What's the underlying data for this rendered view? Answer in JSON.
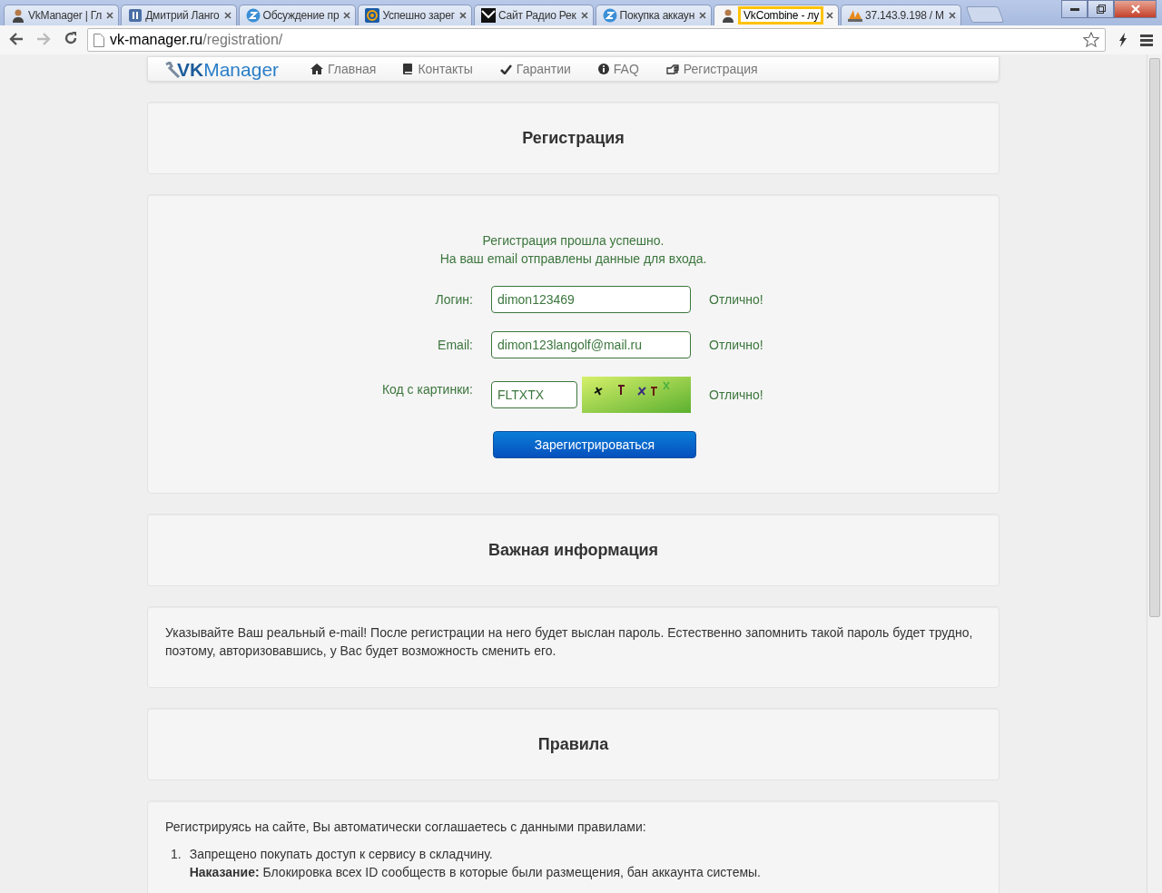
{
  "browser": {
    "tabs": [
      {
        "title": "VkManager | Гл",
        "kind": "person",
        "selected": false,
        "highlighted": false
      },
      {
        "title": "Дмитрий Ланго",
        "kind": "pause",
        "selected": false,
        "highlighted": false
      },
      {
        "title": "Обсуждение пр",
        "kind": "z",
        "selected": false,
        "highlighted": false
      },
      {
        "title": "Успешно зарег",
        "kind": "at",
        "selected": false,
        "highlighted": false
      },
      {
        "title": "Сайт Радио Рек",
        "kind": "mail",
        "selected": false,
        "highlighted": false
      },
      {
        "title": "Покупка аккаун",
        "kind": "z",
        "selected": false,
        "highlighted": false
      },
      {
        "title": "VkCombine - лу",
        "kind": "person",
        "selected": true,
        "highlighted": true
      },
      {
        "title": "37.143.9.198 / М",
        "kind": "pma",
        "selected": false,
        "highlighted": false
      }
    ],
    "address": "vk-manager.ru/registration/"
  },
  "site": {
    "logo": "**VK**Manager",
    "nav": [
      {
        "label": "Главная",
        "kind": "home"
      },
      {
        "label": "Контакты",
        "kind": "book"
      },
      {
        "label": "Гарантии",
        "kind": "check"
      },
      {
        "label": "FAQ",
        "kind": "info"
      },
      {
        "label": "Регистрация",
        "kind": "hand"
      }
    ]
  },
  "registration": {
    "title": "Регистрация",
    "success": [
      "Регистрация прошла успешно.",
      "На ваш email отправлены данные для входа."
    ],
    "fields": [
      {
        "kind": "text",
        "label": "Логин:",
        "value": "dimon123469",
        "status": "Отлично!"
      },
      {
        "kind": "text",
        "label": "Email:",
        "value": "dimon123langolf@mail.ru",
        "status": "Отлично!"
      },
      {
        "kind": "captcha",
        "label": "Код с картинки:",
        "value": "FLTXTX",
        "status": "Отлично!"
      }
    ],
    "submit": "Зарегистрироваться"
  },
  "important": {
    "title": "Важная информация",
    "text": "Указывайте Ваш реальный e-mail! После регистрации на него будет выслан пароль. Естественно запомнить такой пароль будет трудно, поэтому, авторизовавшись, у Вас будет возможность сменить его."
  },
  "rules": {
    "title": "Правила",
    "intro": "Регистрируясь на сайте, Вы автоматически соглашаетесь с данными правилами:",
    "items": [
      {
        "number": "1.",
        "text": "Запрещено покупать доступ к сервису в складчину.",
        "penalty": "**Наказание:** Блокировка всех ID сообществ в которые были размещения, бан аккаунта системы."
      }
    ]
  }
}
